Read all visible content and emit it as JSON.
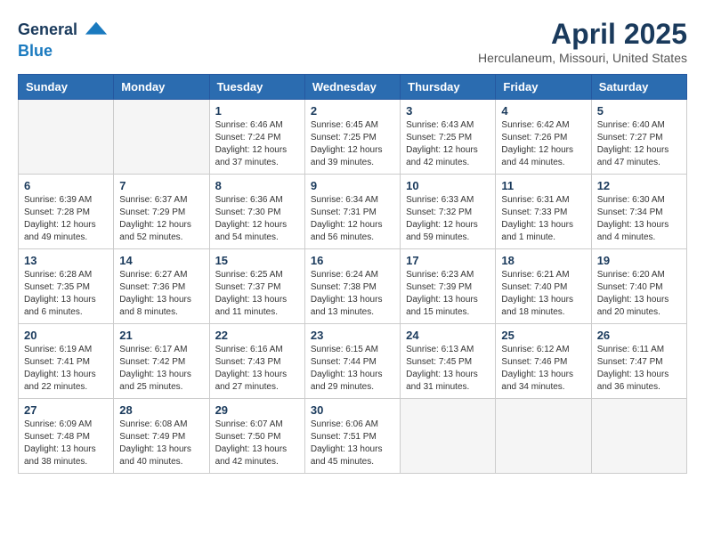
{
  "header": {
    "logo_line1": "General",
    "logo_line2": "Blue",
    "month_title": "April 2025",
    "subtitle": "Herculaneum, Missouri, United States"
  },
  "days_of_week": [
    "Sunday",
    "Monday",
    "Tuesday",
    "Wednesday",
    "Thursday",
    "Friday",
    "Saturday"
  ],
  "weeks": [
    [
      {
        "day": "",
        "info": ""
      },
      {
        "day": "",
        "info": ""
      },
      {
        "day": "1",
        "info": "Sunrise: 6:46 AM\nSunset: 7:24 PM\nDaylight: 12 hours and 37 minutes."
      },
      {
        "day": "2",
        "info": "Sunrise: 6:45 AM\nSunset: 7:25 PM\nDaylight: 12 hours and 39 minutes."
      },
      {
        "day": "3",
        "info": "Sunrise: 6:43 AM\nSunset: 7:25 PM\nDaylight: 12 hours and 42 minutes."
      },
      {
        "day": "4",
        "info": "Sunrise: 6:42 AM\nSunset: 7:26 PM\nDaylight: 12 hours and 44 minutes."
      },
      {
        "day": "5",
        "info": "Sunrise: 6:40 AM\nSunset: 7:27 PM\nDaylight: 12 hours and 47 minutes."
      }
    ],
    [
      {
        "day": "6",
        "info": "Sunrise: 6:39 AM\nSunset: 7:28 PM\nDaylight: 12 hours and 49 minutes."
      },
      {
        "day": "7",
        "info": "Sunrise: 6:37 AM\nSunset: 7:29 PM\nDaylight: 12 hours and 52 minutes."
      },
      {
        "day": "8",
        "info": "Sunrise: 6:36 AM\nSunset: 7:30 PM\nDaylight: 12 hours and 54 minutes."
      },
      {
        "day": "9",
        "info": "Sunrise: 6:34 AM\nSunset: 7:31 PM\nDaylight: 12 hours and 56 minutes."
      },
      {
        "day": "10",
        "info": "Sunrise: 6:33 AM\nSunset: 7:32 PM\nDaylight: 12 hours and 59 minutes."
      },
      {
        "day": "11",
        "info": "Sunrise: 6:31 AM\nSunset: 7:33 PM\nDaylight: 13 hours and 1 minute."
      },
      {
        "day": "12",
        "info": "Sunrise: 6:30 AM\nSunset: 7:34 PM\nDaylight: 13 hours and 4 minutes."
      }
    ],
    [
      {
        "day": "13",
        "info": "Sunrise: 6:28 AM\nSunset: 7:35 PM\nDaylight: 13 hours and 6 minutes."
      },
      {
        "day": "14",
        "info": "Sunrise: 6:27 AM\nSunset: 7:36 PM\nDaylight: 13 hours and 8 minutes."
      },
      {
        "day": "15",
        "info": "Sunrise: 6:25 AM\nSunset: 7:37 PM\nDaylight: 13 hours and 11 minutes."
      },
      {
        "day": "16",
        "info": "Sunrise: 6:24 AM\nSunset: 7:38 PM\nDaylight: 13 hours and 13 minutes."
      },
      {
        "day": "17",
        "info": "Sunrise: 6:23 AM\nSunset: 7:39 PM\nDaylight: 13 hours and 15 minutes."
      },
      {
        "day": "18",
        "info": "Sunrise: 6:21 AM\nSunset: 7:40 PM\nDaylight: 13 hours and 18 minutes."
      },
      {
        "day": "19",
        "info": "Sunrise: 6:20 AM\nSunset: 7:40 PM\nDaylight: 13 hours and 20 minutes."
      }
    ],
    [
      {
        "day": "20",
        "info": "Sunrise: 6:19 AM\nSunset: 7:41 PM\nDaylight: 13 hours and 22 minutes."
      },
      {
        "day": "21",
        "info": "Sunrise: 6:17 AM\nSunset: 7:42 PM\nDaylight: 13 hours and 25 minutes."
      },
      {
        "day": "22",
        "info": "Sunrise: 6:16 AM\nSunset: 7:43 PM\nDaylight: 13 hours and 27 minutes."
      },
      {
        "day": "23",
        "info": "Sunrise: 6:15 AM\nSunset: 7:44 PM\nDaylight: 13 hours and 29 minutes."
      },
      {
        "day": "24",
        "info": "Sunrise: 6:13 AM\nSunset: 7:45 PM\nDaylight: 13 hours and 31 minutes."
      },
      {
        "day": "25",
        "info": "Sunrise: 6:12 AM\nSunset: 7:46 PM\nDaylight: 13 hours and 34 minutes."
      },
      {
        "day": "26",
        "info": "Sunrise: 6:11 AM\nSunset: 7:47 PM\nDaylight: 13 hours and 36 minutes."
      }
    ],
    [
      {
        "day": "27",
        "info": "Sunrise: 6:09 AM\nSunset: 7:48 PM\nDaylight: 13 hours and 38 minutes."
      },
      {
        "day": "28",
        "info": "Sunrise: 6:08 AM\nSunset: 7:49 PM\nDaylight: 13 hours and 40 minutes."
      },
      {
        "day": "29",
        "info": "Sunrise: 6:07 AM\nSunset: 7:50 PM\nDaylight: 13 hours and 42 minutes."
      },
      {
        "day": "30",
        "info": "Sunrise: 6:06 AM\nSunset: 7:51 PM\nDaylight: 13 hours and 45 minutes."
      },
      {
        "day": "",
        "info": ""
      },
      {
        "day": "",
        "info": ""
      },
      {
        "day": "",
        "info": ""
      }
    ]
  ]
}
